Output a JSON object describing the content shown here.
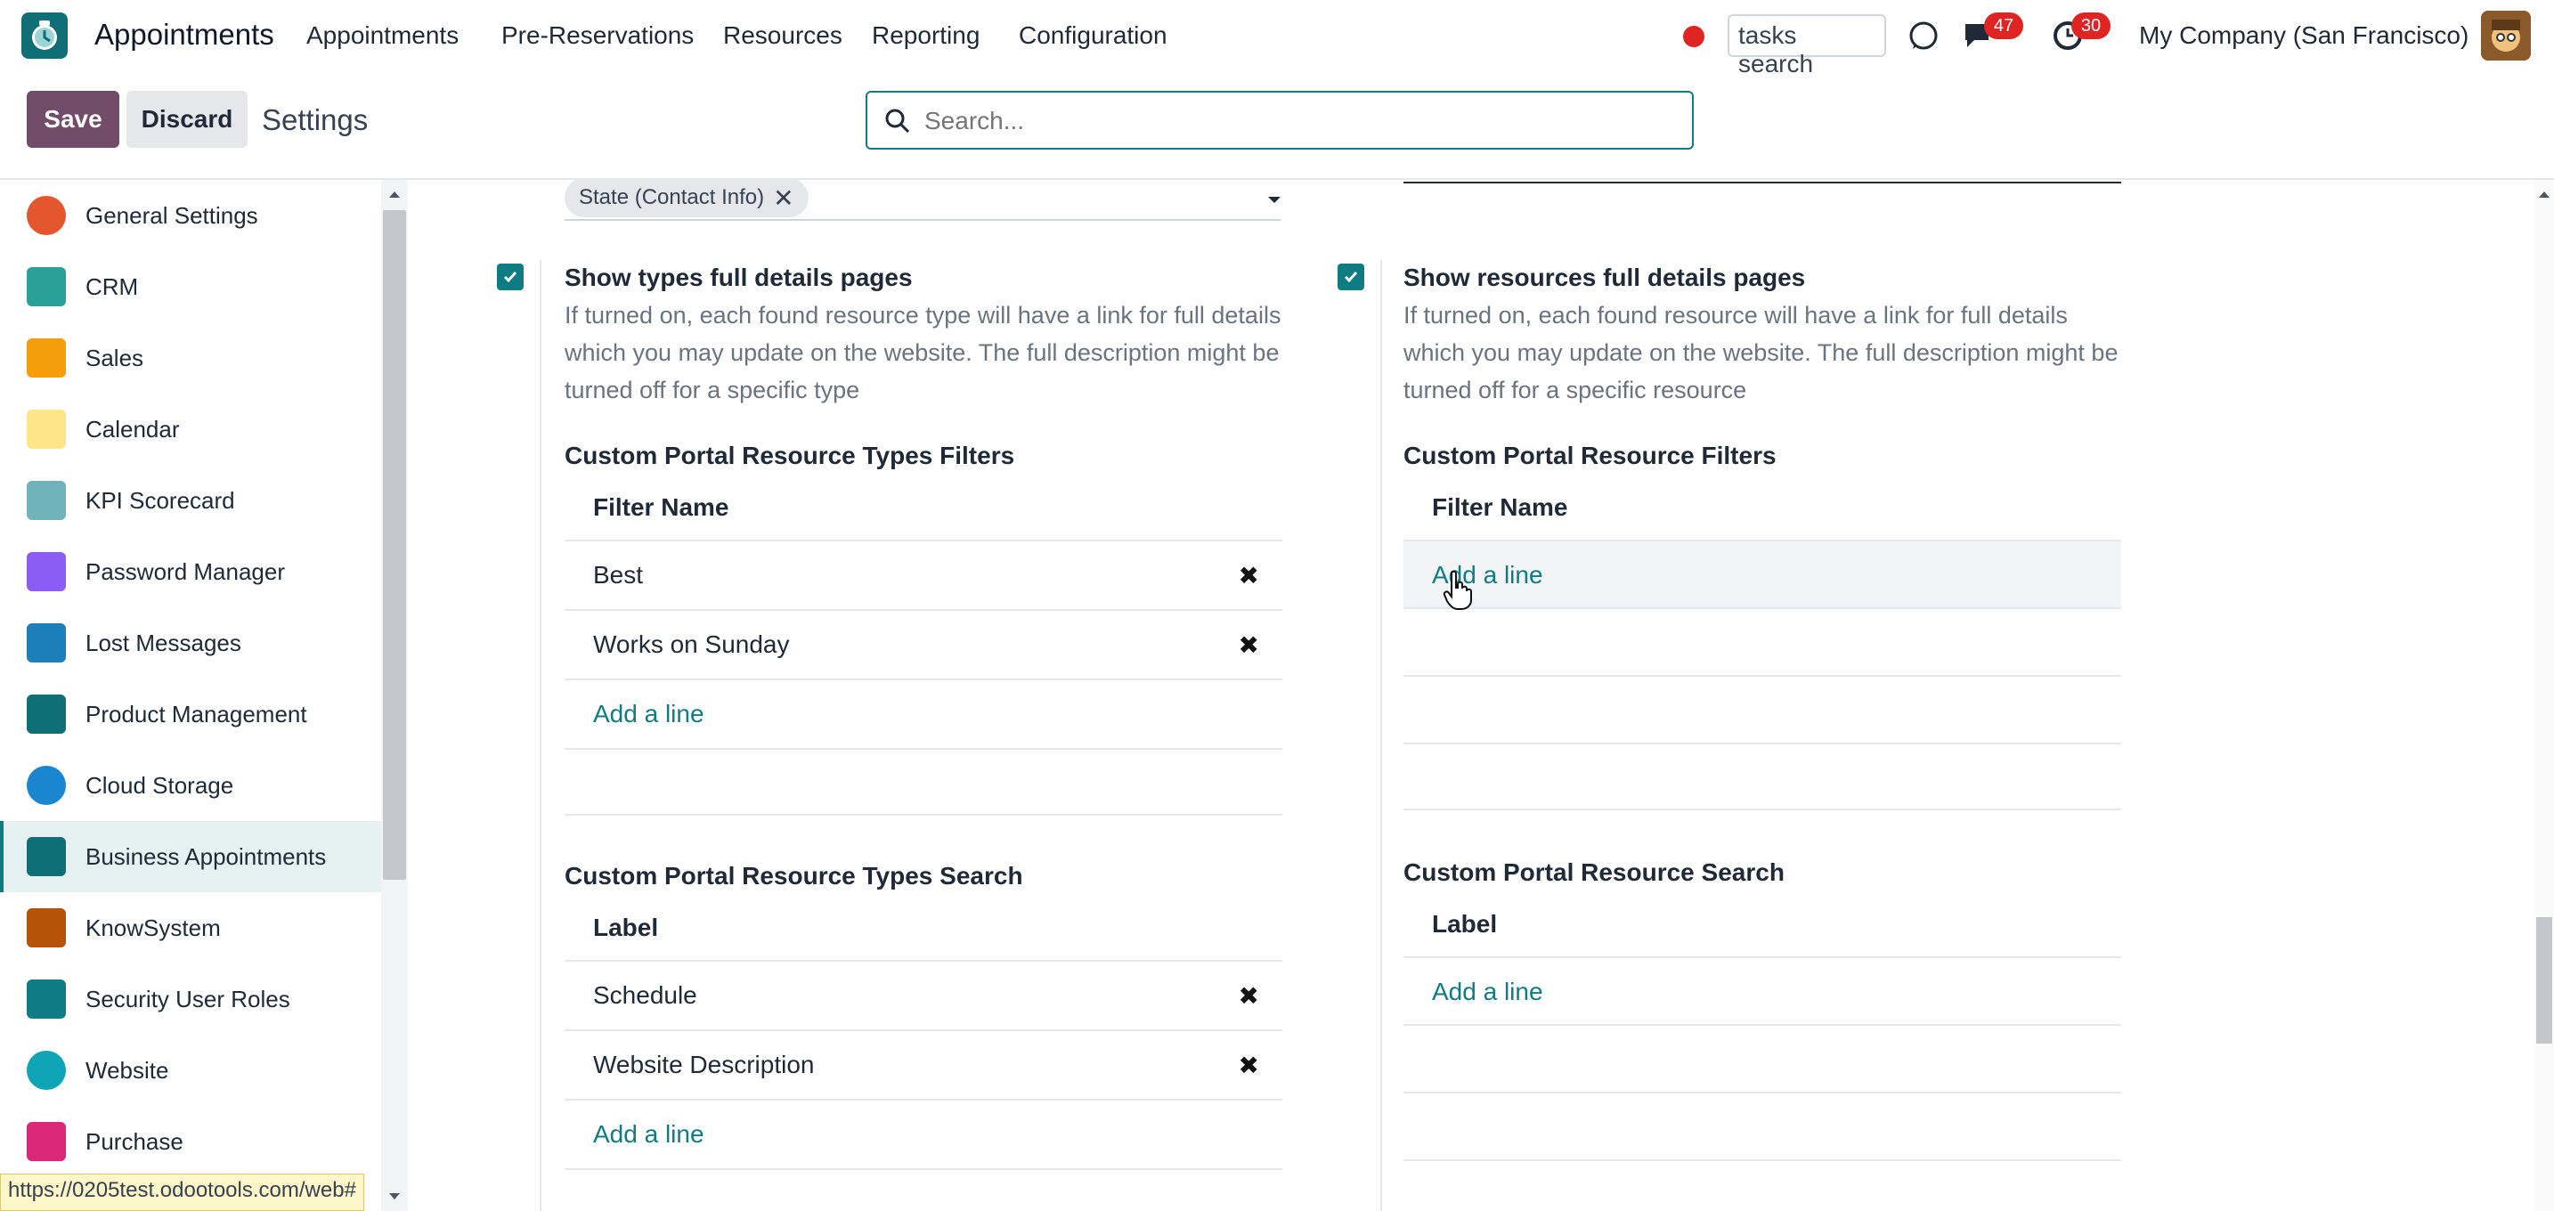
{
  "navbar": {
    "app_name": "Appointments",
    "menu": [
      "Appointments",
      "Pre-Reservations",
      "Resources",
      "Reporting",
      "Configuration"
    ],
    "tasks_search": "tasks search",
    "messages_badge": "47",
    "activities_badge": "30",
    "company": "My Company (San Francisco)"
  },
  "control": {
    "save_label": "Save",
    "discard_label": "Discard",
    "title": "Settings",
    "search_placeholder": "Search..."
  },
  "sidebar": {
    "items": [
      {
        "label": "General Settings",
        "color": "#e4572e"
      },
      {
        "label": "CRM",
        "color": "#2aa198"
      },
      {
        "label": "Sales",
        "color": "#f59e0b"
      },
      {
        "label": "Calendar",
        "color": "#f59e0b"
      },
      {
        "label": "KPI Scorecard",
        "color": "#6fb3b8"
      },
      {
        "label": "Password Manager",
        "color": "#8b5cf6"
      },
      {
        "label": "Lost Messages",
        "color": "#1d7fb8"
      },
      {
        "label": "Product Management",
        "color": "#0f6e76"
      },
      {
        "label": "Cloud Storage",
        "color": "#1a86d0"
      },
      {
        "label": "Business Appointments",
        "color": "#0f6e76"
      },
      {
        "label": "KnowSystem",
        "color": "#b45309"
      },
      {
        "label": "Security User Roles",
        "color": "#0f7b83"
      },
      {
        "label": "Website",
        "color": "#0ea5b7"
      },
      {
        "label": "Purchase",
        "color": "#db2777"
      }
    ],
    "active_index": 9,
    "url_tooltip": "https://0205test.odootools.com/web#"
  },
  "left": {
    "tag": "State (Contact Info)",
    "setting_title": "Show types full details pages",
    "setting_desc": "If turned on, each found resource type will have a link for full details which you may update on the website. The full description might be turned off for a specific type",
    "filters_title": "Custom Portal Resource Types Filters",
    "filters_header": "Filter Name",
    "filters_rows": [
      "Best",
      "Works on Sunday"
    ],
    "search_title": "Custom Portal Resource Types Search",
    "search_header": "Label",
    "search_rows": [
      "Schedule",
      "Website Description"
    ],
    "add_line": "Add a line"
  },
  "right": {
    "setting_title": "Show resources full details pages",
    "setting_desc": "If turned on, each found resource will have a link for full details which you may update on the website. The full description might be turned off for a specific resource",
    "filters_title": "Custom Portal Resource Filters",
    "filters_header": "Filter Name",
    "search_title": "Custom Portal Resource Search",
    "search_header": "Label",
    "add_line": "Add a line"
  }
}
